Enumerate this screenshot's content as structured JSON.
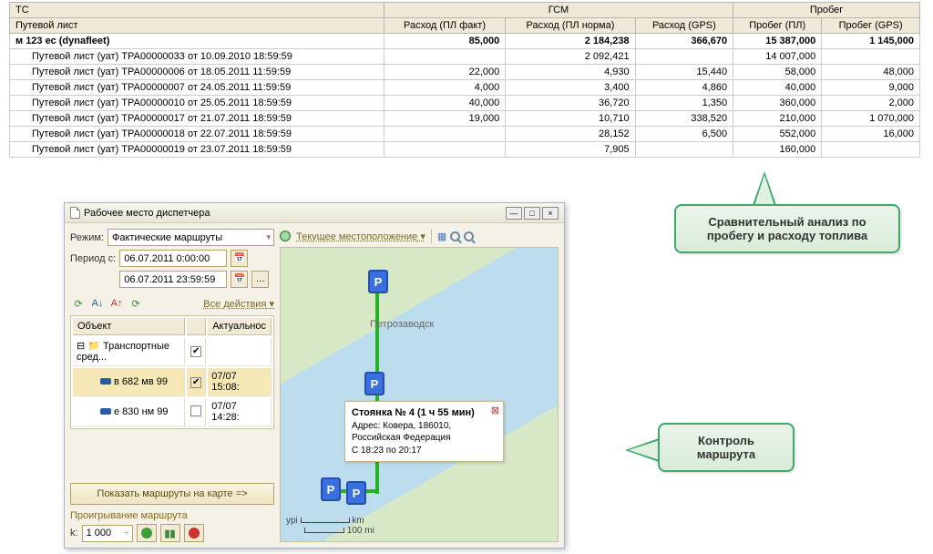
{
  "table": {
    "headers": {
      "tc": "ТС",
      "waybill": "Путевой лист",
      "gsm": "ГСМ",
      "mileage": "Пробег",
      "cons_fact": "Расход (ПЛ факт)",
      "cons_norm": "Расход (ПЛ норма)",
      "cons_gps": "Расход (GPS)",
      "mileage_pl": "Пробег (ПЛ)",
      "mileage_gps": "Пробег (GPS)"
    },
    "group_label": "м 123 ес (dynafleet)",
    "group_totals": {
      "cons_fact": "85,000",
      "cons_norm": "2 184,238",
      "cons_gps": "366,670",
      "mileage_pl": "15 387,000",
      "mileage_gps": "1 145,000"
    },
    "rows": [
      {
        "label": "Путевой лист (уат) ТРА00000033 от 10.09.2010 18:59:59",
        "cons_fact": "",
        "cons_norm": "2 092,421",
        "cons_gps": "",
        "mileage_pl": "14 007,000",
        "mileage_gps": ""
      },
      {
        "label": "Путевой лист (уат) ТРА00000006 от 18.05.2011 11:59:59",
        "cons_fact": "22,000",
        "cons_norm": "4,930",
        "cons_gps": "15,440",
        "mileage_pl": "58,000",
        "mileage_gps": "48,000"
      },
      {
        "label": "Путевой лист (уат) ТРА00000007 от 24.05.2011 11:59:59",
        "cons_fact": "4,000",
        "cons_norm": "3,400",
        "cons_gps": "4,860",
        "mileage_pl": "40,000",
        "mileage_gps": "9,000"
      },
      {
        "label": "Путевой лист (уат) ТРА00000010 от 25.05.2011 18:59:59",
        "cons_fact": "40,000",
        "cons_norm": "36,720",
        "cons_gps": "1,350",
        "mileage_pl": "360,000",
        "mileage_gps": "2,000"
      },
      {
        "label": "Путевой лист (уат) ТРА00000017 от 21.07.2011 18:59:59",
        "cons_fact": "19,000",
        "cons_norm": "10,710",
        "cons_gps": "338,520",
        "mileage_pl": "210,000",
        "mileage_gps": "1 070,000"
      },
      {
        "label": "Путевой лист (уат) ТРА00000018 от 22.07.2011 18:59:59",
        "cons_fact": "",
        "cons_norm": "28,152",
        "cons_gps": "6,500",
        "mileage_pl": "552,000",
        "mileage_gps": "16,000"
      },
      {
        "label": "Путевой лист (уат) ТРА00000019 от 23.07.2011 18:59:59",
        "cons_fact": "",
        "cons_norm": "7,905",
        "cons_gps": "",
        "mileage_pl": "160,000",
        "mileage_gps": ""
      }
    ]
  },
  "callout1": "Сравнительный анализ по пробегу и расходу топлива",
  "callout2": "Контроль маршрута",
  "window": {
    "title": "Рабочее место диспетчера",
    "mode_label": "Режим:",
    "mode_value": "Фактические маршруты",
    "period_label": "Период с:",
    "period_from": "06.07.2011 0:00:00",
    "period_to": "06.07.2011 23:59:59",
    "all_actions": "Все действия",
    "tree": {
      "col_object": "Объект",
      "col_actual": "Актуальнос",
      "root": "Транспортные сред...",
      "item1": "в 682 мв 99",
      "item1_time": "07/07 15:08:",
      "item2": "е 830 нм 99",
      "item2_time": "07/07 14:28:"
    },
    "show_routes_btn": "Показать маршруты на карте =>",
    "playback_label": "Проигрывание маршрута",
    "k_label": "k:",
    "k_value": "1 000",
    "map_toolbar": {
      "current_location": "Текущее местоположение"
    },
    "tooltip": {
      "title": "Стоянка № 4 (1 ч 55 мин)",
      "address": "Адрес: Ковера, 186010, Российская Федерация",
      "time": "С 18:23 по 20:17"
    },
    "city": "Петрозаводск",
    "scale_km": "km",
    "scale_mi": "100 mi",
    "parking_letter": "P"
  }
}
